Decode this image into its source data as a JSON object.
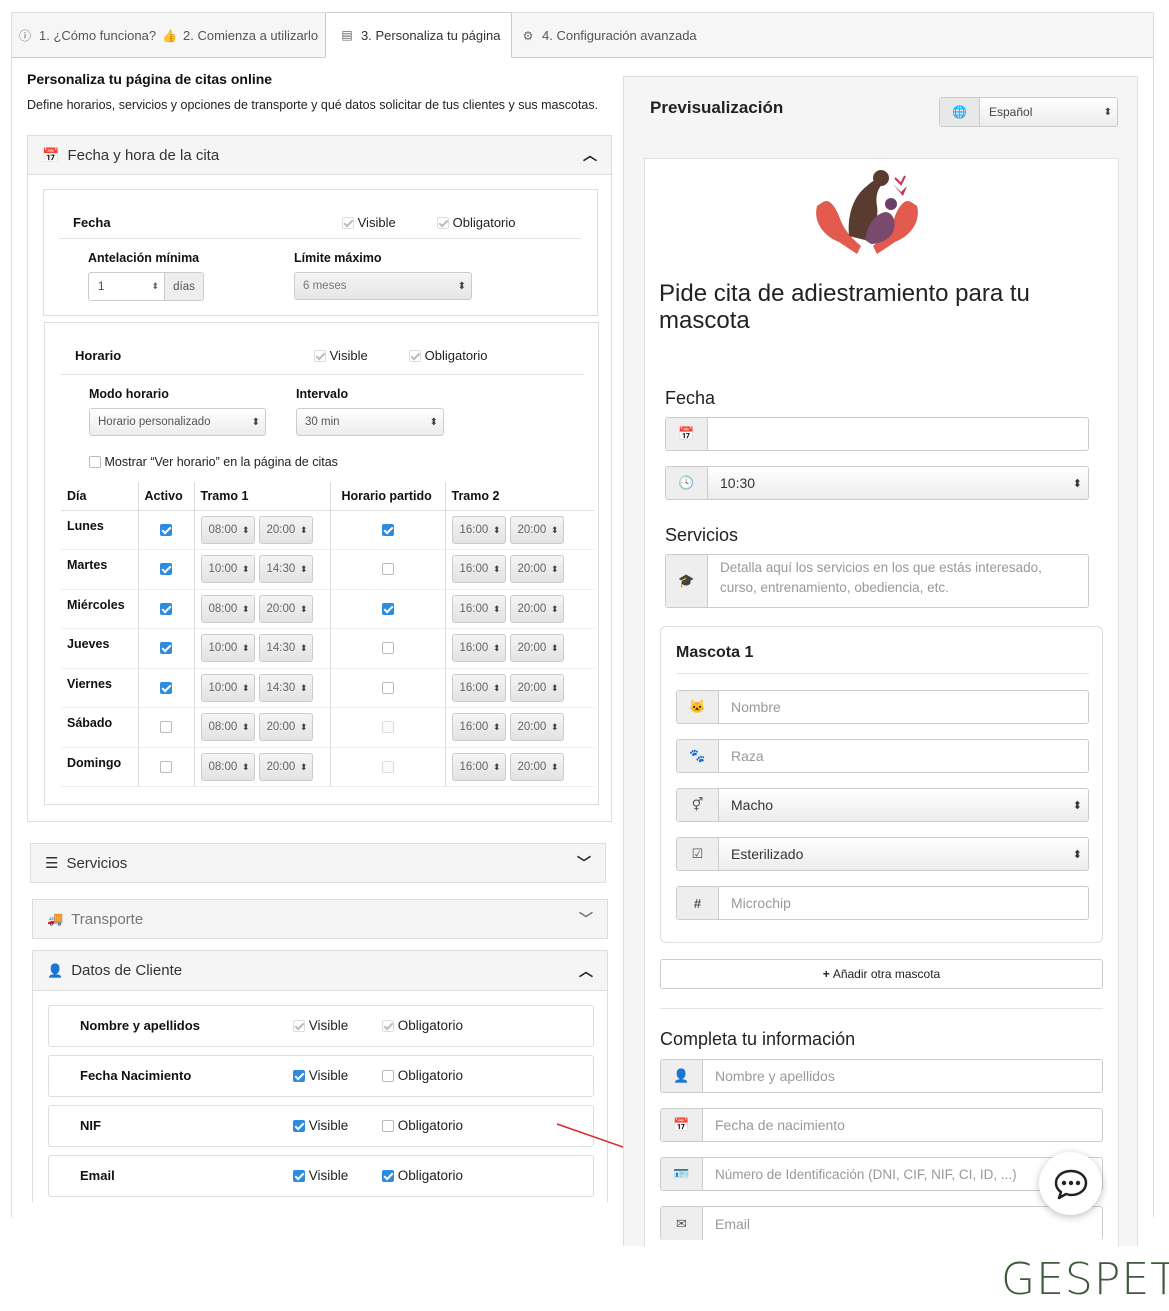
{
  "tabs": [
    {
      "label": "1. ¿Cómo funciona?",
      "icon": "info-icon"
    },
    {
      "label": "2. Comienza a utilizarlo",
      "icon": "thumbs-up-icon"
    },
    {
      "label": "3. Personaliza tu página",
      "icon": "calendar-page-icon"
    },
    {
      "label": "4. Configuración avanzada",
      "icon": "gears-icon"
    }
  ],
  "intro": {
    "title": "Personaliza tu página de citas online",
    "text": "Define horarios, servicios y opciones de transporte y qué datos solicitar de tus clientes y sus mascotas."
  },
  "fecha_panel": {
    "title": "Fecha y hora de la cita",
    "fecha": {
      "label": "Fecha",
      "visible": "Visible",
      "obligatorio": "Obligatorio"
    },
    "antelacion": {
      "label": "Antelación mínima",
      "value": "1",
      "unit": "días"
    },
    "limite": {
      "label": "Límite máximo",
      "value": "6 meses"
    },
    "horario": {
      "label": "Horario",
      "visible": "Visible",
      "obligatorio": "Obligatorio"
    },
    "modo": {
      "label": "Modo horario",
      "value": "Horario personalizado"
    },
    "intervalo": {
      "label": "Intervalo",
      "value": "30 min"
    },
    "mostrar": "Mostrar “Ver horario” en la página de citas",
    "table_headers": [
      "Día",
      "Activo",
      "Tramo 1",
      "Horario partido",
      "Tramo 2"
    ],
    "days": [
      {
        "name": "Lunes",
        "active": true,
        "t1a": "08:00",
        "t1b": "20:00",
        "split": true,
        "t2a": "16:00",
        "t2b": "20:00"
      },
      {
        "name": "Martes",
        "active": true,
        "t1a": "10:00",
        "t1b": "14:30",
        "split": false,
        "t2a": "16:00",
        "t2b": "20:00"
      },
      {
        "name": "Miércoles",
        "active": true,
        "t1a": "08:00",
        "t1b": "20:00",
        "split": true,
        "t2a": "16:00",
        "t2b": "20:00"
      },
      {
        "name": "Jueves",
        "active": true,
        "t1a": "10:00",
        "t1b": "14:30",
        "split": false,
        "t2a": "16:00",
        "t2b": "20:00"
      },
      {
        "name": "Viernes",
        "active": true,
        "t1a": "10:00",
        "t1b": "14:30",
        "split": false,
        "t2a": "16:00",
        "t2b": "20:00"
      },
      {
        "name": "Sábado",
        "active": false,
        "t1a": "08:00",
        "t1b": "20:00",
        "split": false,
        "t2a": "16:00",
        "t2b": "20:00"
      },
      {
        "name": "Domingo",
        "active": false,
        "t1a": "08:00",
        "t1b": "20:00",
        "split": false,
        "t2a": "16:00",
        "t2b": "20:00"
      }
    ]
  },
  "servicios_panel": {
    "title": "Servicios"
  },
  "transporte_panel": {
    "title": "Transporte"
  },
  "cliente_panel": {
    "title": "Datos de Cliente",
    "visible": "Visible",
    "obligatorio": "Obligatorio",
    "rows": [
      {
        "label": "Nombre y apellidos",
        "visible": true,
        "obligatorio": true,
        "locked": true
      },
      {
        "label": "Fecha Nacimiento",
        "visible": true,
        "obligatorio": false,
        "locked": false
      },
      {
        "label": "NIF",
        "visible": true,
        "obligatorio": false,
        "locked": false
      },
      {
        "label": "Email",
        "visible": true,
        "obligatorio": true,
        "locked": false
      }
    ]
  },
  "preview": {
    "title": "Previsualización",
    "language": "Español",
    "heading": "Pide cita de adiestramiento para tu mascota",
    "fecha_label": "Fecha",
    "time_value": "10:30",
    "servicios_label": "Servicios",
    "servicios_placeholder": "Detalla aquí los servicios en los que estás interesado, curso, entrenamiento, obediencia, etc.",
    "mascota_title": "Mascota 1",
    "nombre_ph": "Nombre",
    "raza_ph": "Raza",
    "sexo_value": "Macho",
    "esterilizado_value": "Esterilizado",
    "microchip_ph": "Microchip",
    "add_pet": "Añadir otra mascota",
    "completa_label": "Completa tu información",
    "nombre_apellidos_ph": "Nombre y apellidos",
    "fecha_nac_ph": "Fecha de nacimiento",
    "id_ph": "Número de Identificación (DNI, CIF, NIF, CI, ID, ...)",
    "email_ph": "Email"
  },
  "brand": "GESPET",
  "colors": {
    "accent": "#2d8ce0",
    "brand": "#3d5a3a",
    "arrow": "#d9262b"
  }
}
